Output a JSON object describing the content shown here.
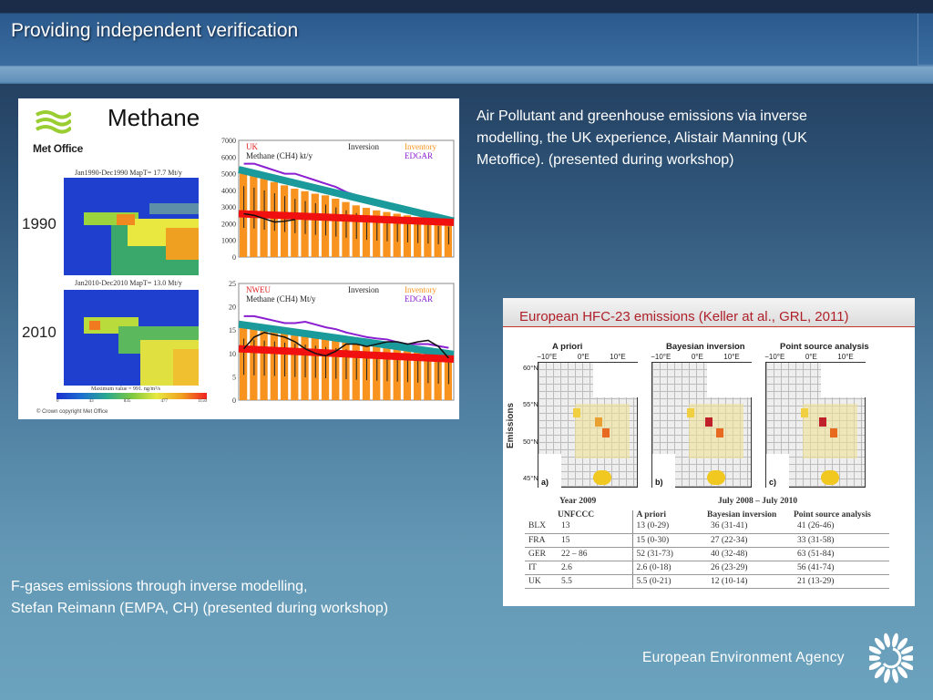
{
  "header": {
    "title": "Providing independent verification"
  },
  "captions": {
    "methane": [
      "Air Pollutant and greenhouse emissions via inverse",
      "modelling, the UK experience, Alistair Manning (UK",
      "Metoffice). (presented during workshop)"
    ],
    "fgases": [
      "F-gases emissions through inverse modelling,",
      "Stefan Reimann (EMPA, CH) (presented during workshop)"
    ]
  },
  "methane_figure": {
    "logo_text": "Met Office",
    "title": "Methane",
    "map1": {
      "year": "1990",
      "caption": "Jan1990-Dec1990  MapT=   17.7 Mt/y"
    },
    "map2": {
      "year": "2010",
      "caption": "Jan2010-Dec2010  MapT=   13.0 Mt/y"
    },
    "colorbar": {
      "caption": "Maximum value = 991. ng/m²/s",
      "ticks": [
        "0",
        "43",
        "835",
        "477",
        "1150"
      ]
    },
    "copyright": "© Crown copyright   Met Office",
    "chart_uk": {
      "region": "UK",
      "unit": "Methane (CH4) kt/y",
      "legend": [
        "Inversion",
        "Inventory",
        "EDGAR"
      ],
      "yticks": [
        "7000",
        "6000",
        "5000",
        "4000",
        "3000",
        "2000",
        "1000",
        "0"
      ],
      "ymax": 7000,
      "inventory": [
        5000,
        4900,
        4700,
        4500,
        4300,
        4100,
        3950,
        3800,
        3700,
        3500,
        3300,
        3100,
        2950,
        2800,
        2700,
        2600,
        2500,
        2400,
        2300,
        2200,
        2150
      ],
      "edgar": [
        5600,
        5600,
        5400,
        5200,
        5000,
        5000,
        4800,
        4600,
        4400,
        4200,
        3900,
        3700,
        3500,
        3350,
        3200,
        3000,
        2800,
        2600,
        2400,
        2200,
        2050
      ],
      "inversion": [
        2600,
        2500,
        2300,
        2100,
        2150,
        2250
      ]
    },
    "chart_nweu": {
      "region": "NWEU",
      "unit": "Methane (CH4) Mt/y",
      "legend": [
        "Inversion",
        "Inventory",
        "EDGAR"
      ],
      "yticks": [
        "25",
        "20",
        "15",
        "10",
        "5",
        "0"
      ],
      "ymax": 25,
      "inventory": [
        15.5,
        15.2,
        15,
        14.8,
        14.5,
        14.2,
        14,
        13.7,
        13.4,
        13.1,
        12.8,
        12.5,
        12.2,
        11.9,
        11.6,
        11.3,
        11,
        10.7,
        10.4,
        10.1,
        9.8
      ],
      "edgar": [
        18,
        18,
        17.5,
        17,
        16.5,
        16.5,
        16.8,
        16.2,
        15.6,
        15.2,
        14.5,
        14,
        13.5,
        13.2,
        13,
        12.4,
        12,
        12,
        12,
        11.6,
        11.2
      ],
      "inversion": [
        11,
        13.5,
        14.5,
        14,
        13.5,
        12.5,
        11,
        10,
        9.5,
        10.5,
        12,
        12,
        11.5,
        12,
        12.5,
        12.5,
        12,
        12.5,
        12.8,
        11.5,
        9
      ]
    },
    "colors": {
      "inventory": "#f7931e",
      "edgar": "#8b1fd0",
      "trend_inventory": "#1a9a9a",
      "trend_inversion": "#f01010",
      "uk_label": "#e02020"
    }
  },
  "hfc_figure": {
    "title": "European HFC-23 emissions (Keller at al., GRL, 2011)",
    "ylabel": "Emissions",
    "panels": [
      {
        "title": "A priori",
        "tag": "a)"
      },
      {
        "title": "Bayesian inversion",
        "tag": "b)"
      },
      {
        "title": "Point source analysis",
        "tag": "c)"
      }
    ],
    "lon_ticks": [
      "−10°E",
      "0°E",
      "10°E"
    ],
    "lat_ticks": [
      "60°N",
      "55°N",
      "50°N",
      "45°N"
    ],
    "table": {
      "group_headers": [
        "Year 2009",
        "July 2008 – July 2010"
      ],
      "columns": [
        "",
        "UNFCCC",
        "A priori",
        "Bayesian inversion",
        "Point source analysis"
      ],
      "rows": [
        [
          "BLX",
          "13",
          "13 (0-29)",
          "36 (31-41)",
          "41 (26-46)"
        ],
        [
          "FRA",
          "15",
          "15 (0-30)",
          "27 (22-34)",
          "33 (31-58)"
        ],
        [
          "GER",
          "22 – 86",
          "52 (31-73)",
          "40 (32-48)",
          "63 (51-84)"
        ],
        [
          "IT",
          "2.6",
          "2.6 (0-18)",
          "26 (23-29)",
          "56 (41-74)"
        ],
        [
          "UK",
          "5.5",
          "5.5 (0-21)",
          "12 (10-14)",
          "21 (13-29)"
        ]
      ]
    }
  },
  "footer": {
    "logo_text": "European Environment Agency"
  }
}
